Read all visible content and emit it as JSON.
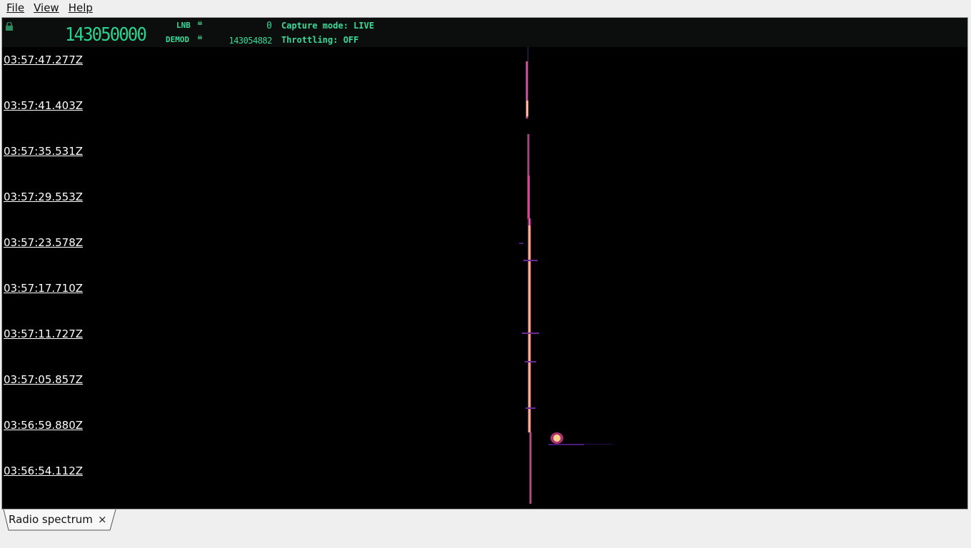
{
  "menu": {
    "file": "File",
    "view": "View",
    "help": "Help"
  },
  "header": {
    "frequency": "143050000",
    "lnb_label": "LNB",
    "lnb_value": "0",
    "demod_label": "DEMOD",
    "demod_value": "143054882",
    "capture_mode": "Capture mode: LIVE",
    "throttling": "Throttling: OFF"
  },
  "timestamps": [
    "03:57:47.277Z",
    "03:57:41.403Z",
    "03:57:35.531Z",
    "03:57:29.553Z",
    "03:57:23.578Z",
    "03:57:17.710Z",
    "03:57:11.727Z",
    "03:57:05.857Z",
    "03:56:59.880Z",
    "03:56:54.112Z"
  ],
  "tabs": [
    {
      "label": "Radio spectrum",
      "close": "×"
    }
  ],
  "colors": {
    "accent": "#3bd99a",
    "background": "#000000",
    "signal_hot": "#fcd28a",
    "signal_mid": "#d0418a",
    "signal_low": "#5b1a8a"
  }
}
